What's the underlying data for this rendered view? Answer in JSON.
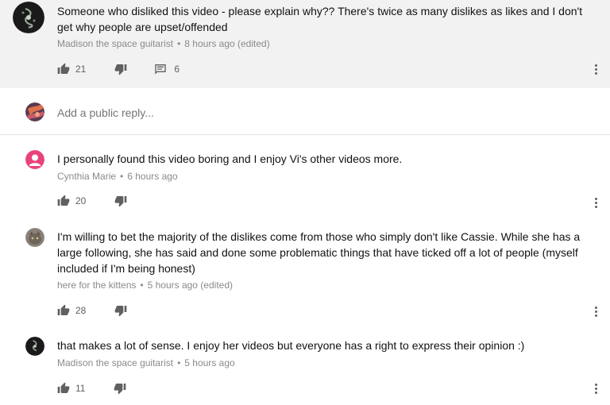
{
  "colors": {
    "top_comment_bg": "#f2f2f2",
    "meta_text": "#8a8a8a",
    "action_gray": "#606060"
  },
  "top_comment": {
    "text": "Someone who disliked this video - please explain why?? There's twice as many dislikes as likes and I don't get why people are upset/offended",
    "author": "Madison the space guitarist",
    "time": "8 hours ago (edited)",
    "likes": "21",
    "replies": "6",
    "icons": [
      "thumb-up-icon",
      "thumb-down-icon",
      "comment-icon",
      "more-vert-icon"
    ]
  },
  "reply_box": {
    "placeholder": "Add a public reply..."
  },
  "comments": [
    {
      "text": "I personally found this video boring and I enjoy Vi's other videos more.",
      "author": "Cynthia Marie",
      "time": "6 hours ago",
      "likes": "20"
    },
    {
      "text": "I'm willing to bet the majority of the dislikes come from those who simply don't like Cassie. While she has a large following, she has said and done some problematic things that have ticked off a lot of people (myself included if I'm being honest)",
      "author": "here for the kittens",
      "time": "5 hours ago (edited)",
      "likes": "28"
    },
    {
      "text": "that makes a lot of sense. I enjoy her videos but everyone has a right to express their opinion :)",
      "author": "Madison the space guitarist",
      "time": "5 hours ago",
      "likes": "11"
    }
  ],
  "separator": "•"
}
